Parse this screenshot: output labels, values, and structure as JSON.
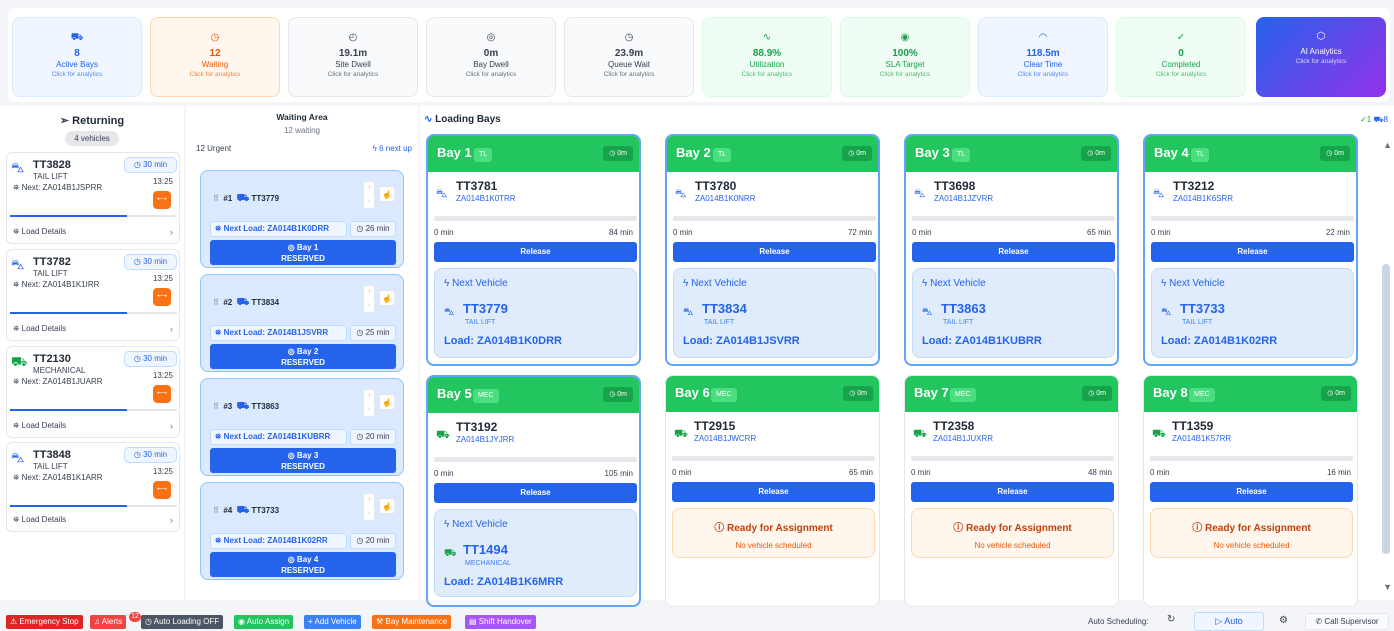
{
  "stats": [
    {
      "icon": "⛟",
      "value": "8",
      "label": "Active Bays",
      "hint": "Click for analytics",
      "tone": "blue"
    },
    {
      "icon": "◷",
      "value": "12",
      "label": "Waiting",
      "hint": "Click for analytics",
      "tone": "orange"
    },
    {
      "icon": "◴",
      "value": "19.1m",
      "label": "Site Dwell",
      "hint": "Click for analytics",
      "tone": "neutral"
    },
    {
      "icon": "◎",
      "value": "0m",
      "label": "Bay Dwell",
      "hint": "Click for analytics",
      "tone": "neutral"
    },
    {
      "icon": "◷",
      "value": "23.9m",
      "label": "Queue Wait",
      "hint": "Click for analytics",
      "tone": "neutral"
    },
    {
      "icon": "∿",
      "value": "88.9%",
      "label": "Utilization",
      "hint": "Click for analytics",
      "tone": "green"
    },
    {
      "icon": "◉",
      "value": "100%",
      "label": "SLA Target",
      "hint": "Click for analytics",
      "tone": "green"
    },
    {
      "icon": "◠",
      "value": "118.5m",
      "label": "Clear Time",
      "hint": "Click for analytics",
      "tone": "blue"
    },
    {
      "icon": "✓",
      "value": "0",
      "label": "Completed",
      "hint": "Click for analytics",
      "tone": "green"
    },
    {
      "icon": "⬡",
      "value": "",
      "label": "AI Analytics",
      "hint": "Click for analytics",
      "tone": "ai"
    }
  ],
  "returning": {
    "title": "Returning",
    "count": "4 vehicles",
    "cards": [
      {
        "id": "TT3828",
        "type": "TAIL LIFT",
        "next": "Next: ZA014B1JSPRR",
        "timer": "30 min",
        "time": "13:25",
        "details": "Load Details"
      },
      {
        "id": "TT3782",
        "type": "TAIL LIFT",
        "next": "Next: ZA014B1K1IRR",
        "timer": "30 min",
        "time": "13:25",
        "details": "Load Details"
      },
      {
        "id": "TT2130",
        "type": "MECHANICAL",
        "next": "Next: ZA014B1JUARR",
        "timer": "30 min",
        "time": "13:25",
        "details": "Load Details"
      },
      {
        "id": "TT3848",
        "type": "TAIL LIFT",
        "next": "Next: ZA014B1K1ARR",
        "timer": "30 min",
        "time": "13:25",
        "details": "Load Details"
      }
    ]
  },
  "waiting": {
    "title": "Waiting Area",
    "sub": "12 waiting",
    "urgent": "12 Urgent",
    "nextup": "6 next up",
    "cards": [
      {
        "num": "#1",
        "id": "TT3779",
        "load": "Next Load: ZA014B1K0DRR",
        "wait": "26 min",
        "bay": "Bay 1",
        "status": "RESERVED"
      },
      {
        "num": "#2",
        "id": "TT3834",
        "load": "Next Load: ZA014B1JSVRR",
        "wait": "25 min",
        "bay": "Bay 2",
        "status": "RESERVED"
      },
      {
        "num": "#3",
        "id": "TT3863",
        "load": "Next Load: ZA014B1KUBRR",
        "wait": "20 min",
        "bay": "Bay 3",
        "status": "RESERVED"
      },
      {
        "num": "#4",
        "id": "TT3733",
        "load": "Next Load: ZA014B1K02RR",
        "wait": "20 min",
        "bay": "Bay 4",
        "status": "RESERVED"
      }
    ]
  },
  "bays_header": {
    "title": "Loading Bays",
    "done": "1",
    "trucks": "8"
  },
  "bays": [
    {
      "name": "Bay 1",
      "tag": "TL",
      "timer": "0m",
      "vehicle": "TT3781",
      "load": "ZA014B1K0TRR",
      "start": "0 min",
      "end": "84 min",
      "release": "Release",
      "next": {
        "title": "Next Vehicle",
        "id": "TT3779",
        "type": "TAIL LIFT",
        "load": "Load: ZA014B1K0DRR"
      }
    },
    {
      "name": "Bay 2",
      "tag": "TL",
      "timer": "0m",
      "vehicle": "TT3780",
      "load": "ZA014B1K0NRR",
      "start": "0 min",
      "end": "72 min",
      "release": "Release",
      "next": {
        "title": "Next Vehicle",
        "id": "TT3834",
        "type": "TAIL LIFT",
        "load": "Load: ZA014B1JSVRR"
      }
    },
    {
      "name": "Bay 3",
      "tag": "TL",
      "timer": "0m",
      "vehicle": "TT3698",
      "load": "ZA014B1JZVRR",
      "start": "0 min",
      "end": "65 min",
      "release": "Release",
      "next": {
        "title": "Next Vehicle",
        "id": "TT3863",
        "type": "TAIL LIFT",
        "load": "Load: ZA014B1KUBRR"
      }
    },
    {
      "name": "Bay 4",
      "tag": "TL",
      "timer": "0m",
      "vehicle": "TT3212",
      "load": "ZA014B1K6SRR",
      "start": "0 min",
      "end": "22 min",
      "release": "Release",
      "next": {
        "title": "Next Vehicle",
        "id": "TT3733",
        "type": "TAIL LIFT",
        "load": "Load: ZA014B1K02RR"
      }
    },
    {
      "name": "Bay 5",
      "tag": "MEC",
      "timer": "0m",
      "vehicle": "TT3192",
      "load": "ZA014B1JYJRR",
      "start": "0 min",
      "end": "105 min",
      "release": "Release",
      "next": {
        "title": "Next Vehicle",
        "id": "TT1494",
        "type": "MECHANICAL",
        "load": "Load: ZA014B1K6MRR"
      }
    },
    {
      "name": "Bay 6",
      "tag": "MEC",
      "timer": "0m",
      "vehicle": "TT2915",
      "load": "ZA014B1JWCRR",
      "start": "0 min",
      "end": "65 min",
      "release": "Release",
      "ready": {
        "title": "Ready for Assignment",
        "sub": "No vehicle scheduled"
      }
    },
    {
      "name": "Bay 7",
      "tag": "MEC",
      "timer": "0m",
      "vehicle": "TT2358",
      "load": "ZA014B1JUXRR",
      "start": "0 min",
      "end": "48 min",
      "release": "Release",
      "ready": {
        "title": "Ready for Assignment",
        "sub": "No vehicle scheduled"
      }
    },
    {
      "name": "Bay 8",
      "tag": "MEC",
      "timer": "0m",
      "vehicle": "TT1359",
      "load": "ZA014B1K57RR",
      "start": "0 min",
      "end": "16 min",
      "release": "Release",
      "ready": {
        "title": "Ready for Assignment",
        "sub": "No vehicle scheduled"
      }
    }
  ],
  "footer": {
    "buttons": [
      {
        "label": "Emergency Stop",
        "icon": "⚠",
        "color": "#dc2626"
      },
      {
        "label": "Alerts",
        "icon": "♫",
        "color": "#ef4444",
        "badge": "12"
      },
      {
        "label": "Auto Loading OFF",
        "icon": "◷",
        "color": "#4b5563"
      },
      {
        "label": "Auto Assign",
        "icon": "◉",
        "color": "#22c55e"
      },
      {
        "label": "Add Vehicle",
        "icon": "+",
        "color": "#3b82f6"
      },
      {
        "label": "Bay Maintenance",
        "icon": "⚒",
        "color": "#f97316"
      },
      {
        "label": "Shift Handover",
        "icon": "▤",
        "color": "#a855f7"
      }
    ],
    "auto_label": "Auto Scheduling:",
    "auto_btn": "Auto",
    "call": "Call Supervisor"
  }
}
